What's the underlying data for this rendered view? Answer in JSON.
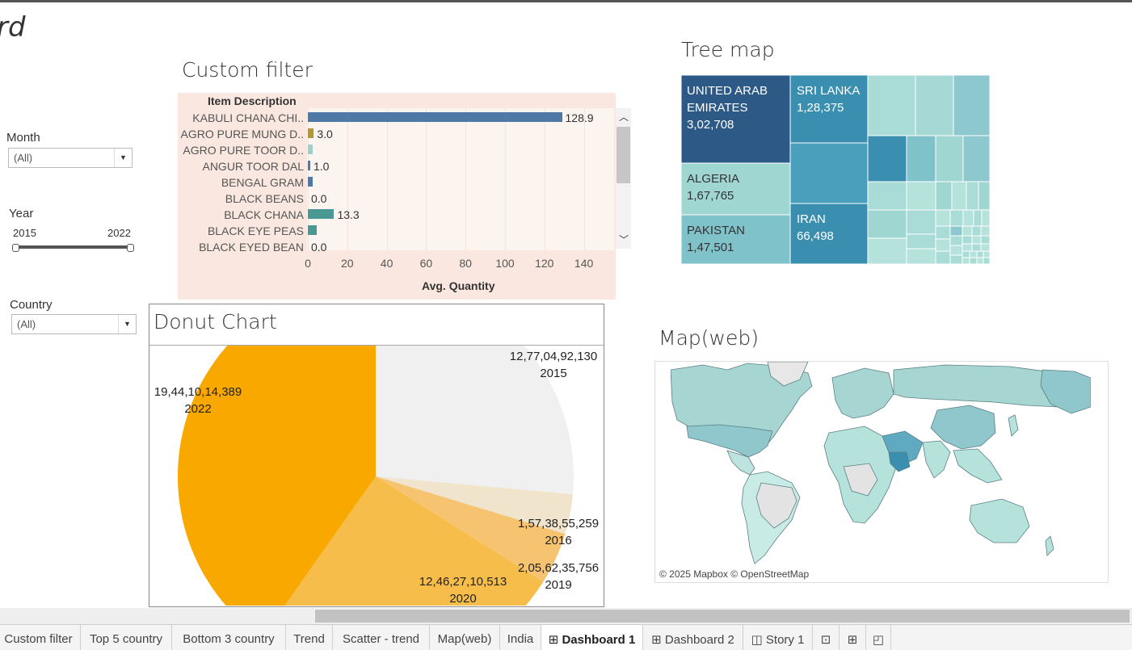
{
  "dashboard": {
    "title_fragment": "rd"
  },
  "filters": {
    "month": {
      "label": "Month",
      "value": "(All)"
    },
    "year": {
      "label": "Year",
      "min": "2015",
      "max": "2022",
      "range": [
        2015,
        2022
      ]
    },
    "country": {
      "label": "Country",
      "value": "(All)"
    }
  },
  "custom_filter": {
    "title": "Custom filter",
    "column_header": "Item Description",
    "x_axis_title": "Avg. Quantity",
    "ticks": [
      "0",
      "20",
      "40",
      "60",
      "80",
      "100",
      "120",
      "140"
    ]
  },
  "tree_map": {
    "title": "Tree map",
    "cells": [
      {
        "name": "UNITED ARAB EMIRATES",
        "value": "3,02,708",
        "color": "#2c5985"
      },
      {
        "name": "SRI LANKA",
        "value": "1,28,375",
        "color": "#3a8fb0"
      },
      {
        "name": "ALGERIA",
        "value": "1,67,765",
        "color": "#9fd6d2"
      },
      {
        "name": "PAKISTAN",
        "value": "1,47,501",
        "color": "#7fc2c9"
      },
      {
        "name": "IRAN",
        "value": "66,498",
        "color": "#3a8fb0"
      }
    ]
  },
  "donut": {
    "title": "Donut Chart",
    "labels": [
      {
        "value": "12,77,04,92,130",
        "year": "2015"
      },
      {
        "value": "19,44,10,14,389",
        "year": "2022"
      },
      {
        "value": "1,57,38,55,259",
        "year": "2016"
      },
      {
        "value": "2,05,62,35,756",
        "year": "2019"
      },
      {
        "value": "12,46,27,10,513",
        "year": "2020"
      }
    ]
  },
  "map": {
    "title": "Map(web)",
    "attribution": "© 2025 Mapbox © OpenStreetMap"
  },
  "tabs": [
    {
      "label": "Custom filter",
      "active": false
    },
    {
      "label": "Top 5 country",
      "active": false
    },
    {
      "label": "Bottom 3 country",
      "active": false
    },
    {
      "label": "Trend",
      "active": false
    },
    {
      "label": "Scatter - trend",
      "active": false
    },
    {
      "label": "Map(web)",
      "active": false
    },
    {
      "label": "India",
      "active": false
    },
    {
      "label": "Dashboard 1",
      "active": true
    },
    {
      "label": "Dashboard 2",
      "active": false
    },
    {
      "label": "Story 1",
      "active": false
    }
  ],
  "icons": {
    "dashboard_tab": "dashboard-grid-icon",
    "story_tab": "story-icon",
    "new_sheet": "new-worksheet-icon",
    "new_dashboard": "new-dashboard-icon",
    "new_story": "new-story-icon",
    "scroll_up": "chevron-up-icon",
    "scroll_down": "chevron-down-icon"
  },
  "chart_data": [
    {
      "type": "bar",
      "orientation": "horizontal",
      "xlabel": "Avg. Quantity",
      "ylabel": "Item Description",
      "xlim": [
        0,
        150
      ],
      "categories": [
        "KABULI CHANA  CHI..",
        "AGRO PURE MUNG D..",
        "AGRO PURE TOOR D..",
        "ANGUR TOOR DAL",
        "BENGAL GRAM",
        "BLACK BEANS",
        "BLACK CHANA",
        "BLACK EYE PEAS",
        "BLACK EYED BEAN"
      ],
      "values": [
        128.9,
        3.0,
        2.5,
        1.0,
        2.5,
        0.0,
        13.3,
        4.5,
        0.0
      ],
      "value_labels": [
        "128.9",
        "3.0",
        "",
        "1.0",
        "",
        "0.0",
        "13.3",
        "",
        "0.0"
      ],
      "colors": [
        "#4e79a7",
        "#b8962e",
        "#9fcfc8",
        "#4e79a7",
        "#4e79a7",
        "#4e79a7",
        "#499894",
        "#499894",
        "#4e79a7"
      ]
    },
    {
      "type": "pie",
      "title": "Donut Chart",
      "categories": [
        "2015",
        "2016",
        "2019",
        "2020",
        "2022"
      ],
      "values": [
        12770492130,
        1573855259,
        2056235756,
        12462710513,
        19441014389
      ],
      "colors": [
        "#f0f0f0",
        "#f0e4cc",
        "#f6c470",
        "#f7bd4a",
        "#f9a800"
      ]
    }
  ]
}
